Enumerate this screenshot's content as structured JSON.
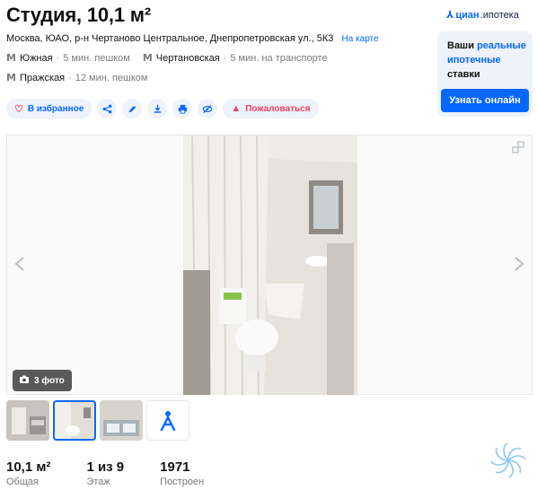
{
  "listing": {
    "title": "Студия, 10,1 м²",
    "address": "Москва, ЮАО, р-н Чертаново Центральное, Днепропетровская ул., 5К3",
    "map_link": "На карте"
  },
  "metro": [
    {
      "station": "Южная",
      "time": "5 мин. пешком"
    },
    {
      "station": "Чертановская",
      "time": "5 мин. на транспорте"
    },
    {
      "station": "Пражская",
      "time": "12 мин. пешком"
    }
  ],
  "metro_symbol": "M",
  "actions": {
    "favorite_label": "В избранное",
    "complain_label": "Пожаловаться"
  },
  "brand": {
    "name": "циан",
    "product": ".ипотека"
  },
  "promo": {
    "text_plain_1": "Ваши ",
    "text_blue": "реальные ипотечные",
    "text_plain_2": " ставки",
    "button": "Узнать онлайн"
  },
  "gallery": {
    "photo_count": "3 фото"
  },
  "facts": [
    {
      "value": "10,1 м²",
      "label": "Общая"
    },
    {
      "value": "1 из 9",
      "label": "Этаж"
    },
    {
      "value": "1971",
      "label": "Построен"
    }
  ],
  "colors": {
    "accent": "#0468ff",
    "danger": "#e84260",
    "chip_bg": "#eef2fb"
  },
  "icons": [
    "heart-icon",
    "share-icon",
    "edit-icon",
    "download-icon",
    "print-icon",
    "hide-icon",
    "warning-icon",
    "expand-icon",
    "camera-icon",
    "tour-icon"
  ]
}
